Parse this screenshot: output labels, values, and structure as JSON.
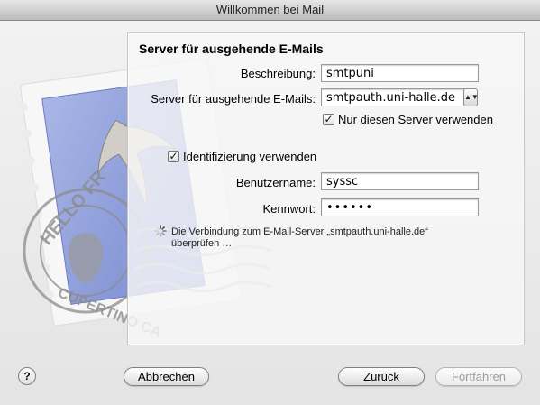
{
  "window": {
    "title": "Willkommen bei Mail"
  },
  "panel": {
    "title": "Server für ausgehende E-Mails"
  },
  "form": {
    "description_label": "Beschreibung:",
    "description_value": "smtpuni",
    "server_label": "Server für ausgehende E-Mails:",
    "server_value": "smtpauth.uni-halle.de",
    "only_server_label": "Nur diesen Server verwenden",
    "only_server_checked": true,
    "use_auth_label": "Identifizierung verwenden",
    "use_auth_checked": true,
    "username_label": "Benutzername:",
    "username_value": "syssc",
    "password_label": "Kennwort:",
    "password_value": "••••••"
  },
  "status": {
    "line1": "Die Verbindung zum E-Mail-Server „smtpauth.uni-halle.de“",
    "line2": "überprüfen …"
  },
  "buttons": {
    "help": "?",
    "cancel": "Abbrechen",
    "back": "Zurück",
    "continue": "Fortfahren"
  },
  "stamp": {
    "text": "HELLO FROM CUPERTINO CA"
  },
  "icons": {
    "checkmark": "✓",
    "dropdown": "▲▼"
  }
}
